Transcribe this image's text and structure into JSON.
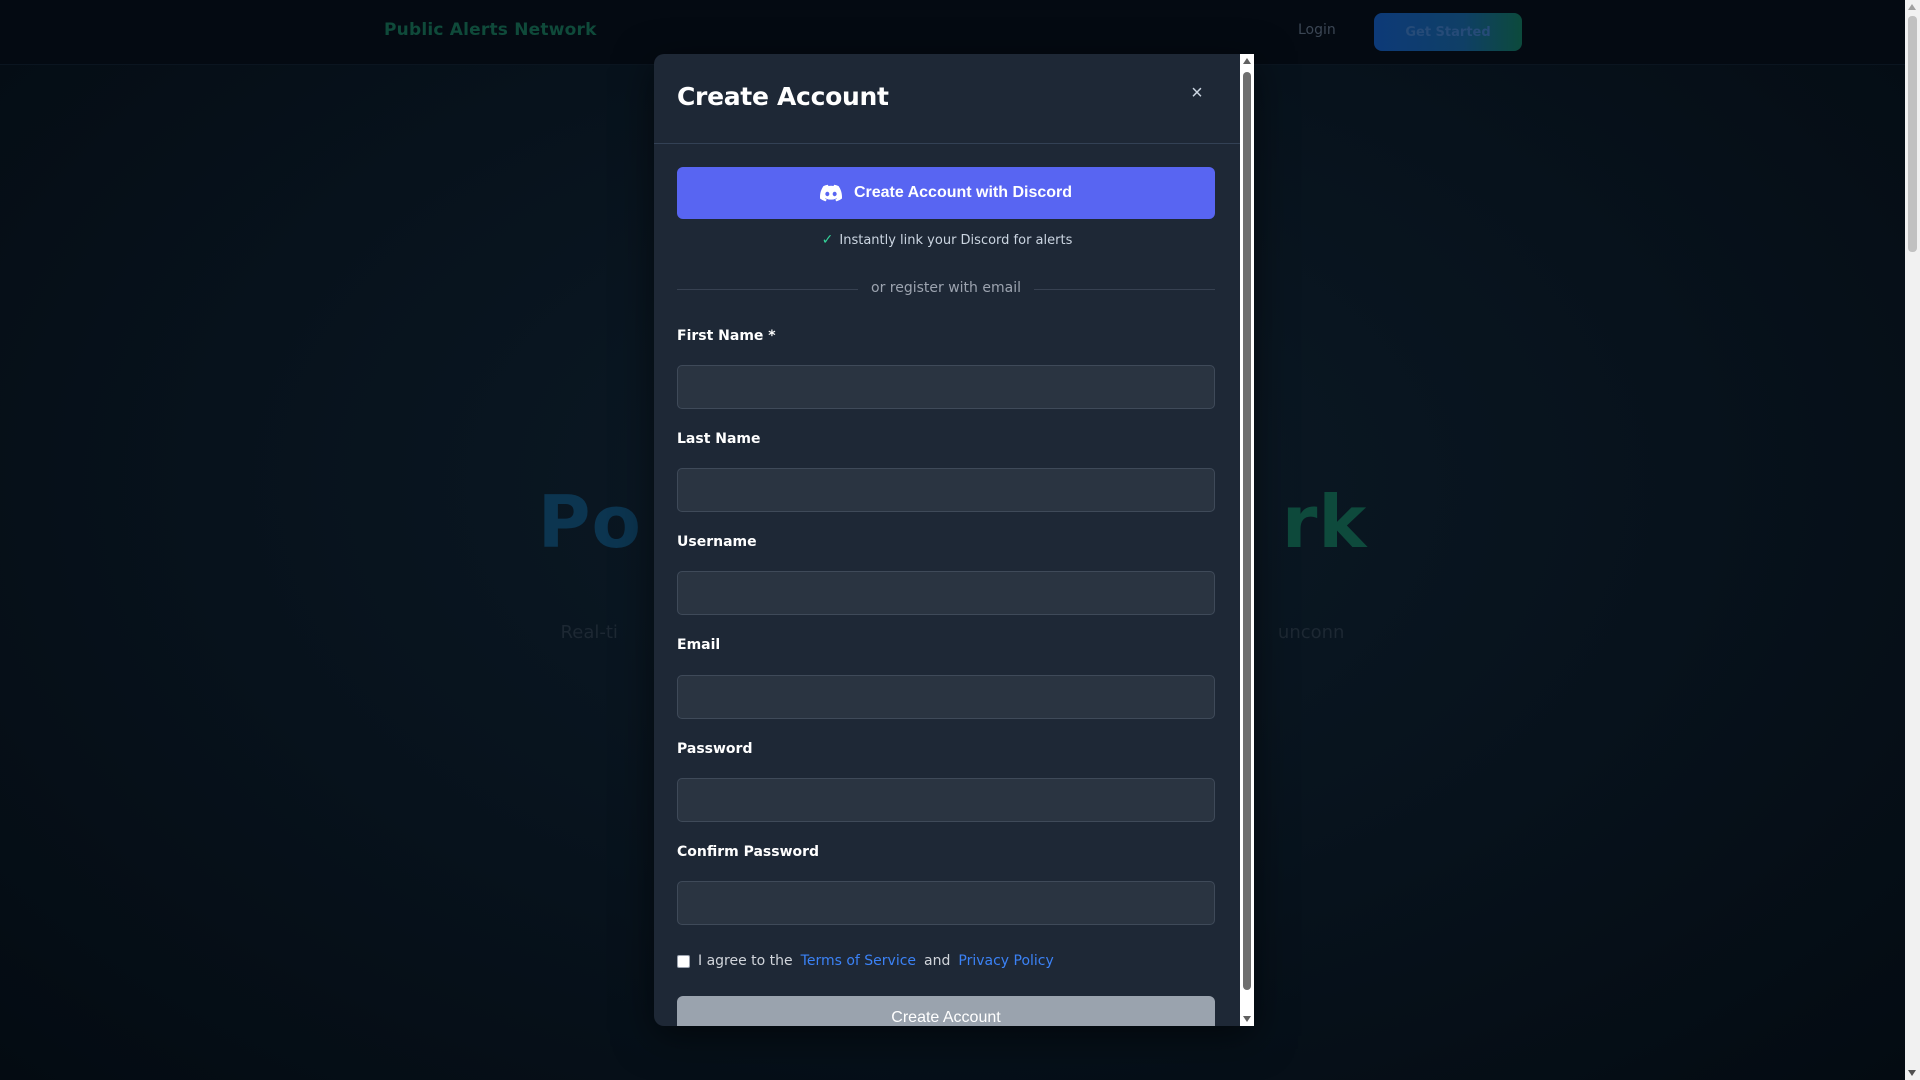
{
  "navbar": {
    "brand": "Public Alerts Network",
    "login": "Login",
    "cta": "Get Started"
  },
  "hero": {
    "title_left": "Po",
    "title_right": "rk",
    "subtitle_left": "Real-ti",
    "subtitle_right": "unconn"
  },
  "modal": {
    "title": "Create Account",
    "close_symbol": "×",
    "discord_button_label": "Create Account with Discord",
    "discord_perk": "Instantly link your Discord for alerts",
    "divider_text": "or register with email",
    "fields": [
      {
        "label": "First Name *",
        "value": "",
        "placeholder": ""
      },
      {
        "label": "Last Name",
        "value": "",
        "placeholder": ""
      },
      {
        "label": "Username",
        "value": "",
        "placeholder": ""
      },
      {
        "label": "Email",
        "value": "",
        "placeholder": ""
      },
      {
        "label": "Password",
        "value": "",
        "placeholder": ""
      },
      {
        "label": "Confirm Password",
        "value": "",
        "placeholder": ""
      }
    ],
    "agree": {
      "prefix": "I agree to the",
      "terms_link": "Terms of Service",
      "and": "and",
      "privacy_link": "Privacy Policy",
      "checked": false
    },
    "submit_label": "Create Account"
  },
  "colors": {
    "discord": "#5865f2",
    "link": "#3b82f6",
    "check": "#34d399",
    "modal_bg": "#1e2836",
    "input_bg": "#2a3441"
  }
}
